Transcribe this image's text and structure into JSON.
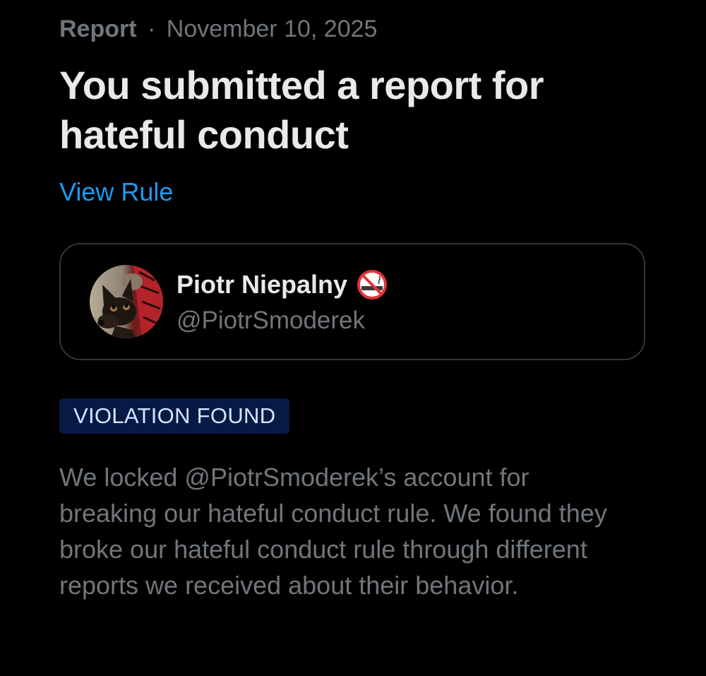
{
  "header": {
    "label": "Report",
    "separator": "·",
    "date": "November 10, 2025"
  },
  "title": "You submitted a report for hateful conduct",
  "view_rule_link": "View Rule",
  "reported_user": {
    "display_name": "Piotr Niepalny",
    "name_icon": "no-smoking-icon",
    "handle": "@PiotrSmoderek",
    "avatar": "dog-photo-avatar"
  },
  "status_badge": "VIOLATION FOUND",
  "description": "We locked @PiotrSmoderek’s account for breaking our hateful conduct rule. We found they broke our hateful conduct rule through different reports we received about their behavior.",
  "colors": {
    "background": "#000000",
    "primary_text": "#e7e9ea",
    "secondary_text": "#71767b",
    "link": "#1d9bf0",
    "badge_background": "#061a45",
    "card_border": "#333639"
  }
}
